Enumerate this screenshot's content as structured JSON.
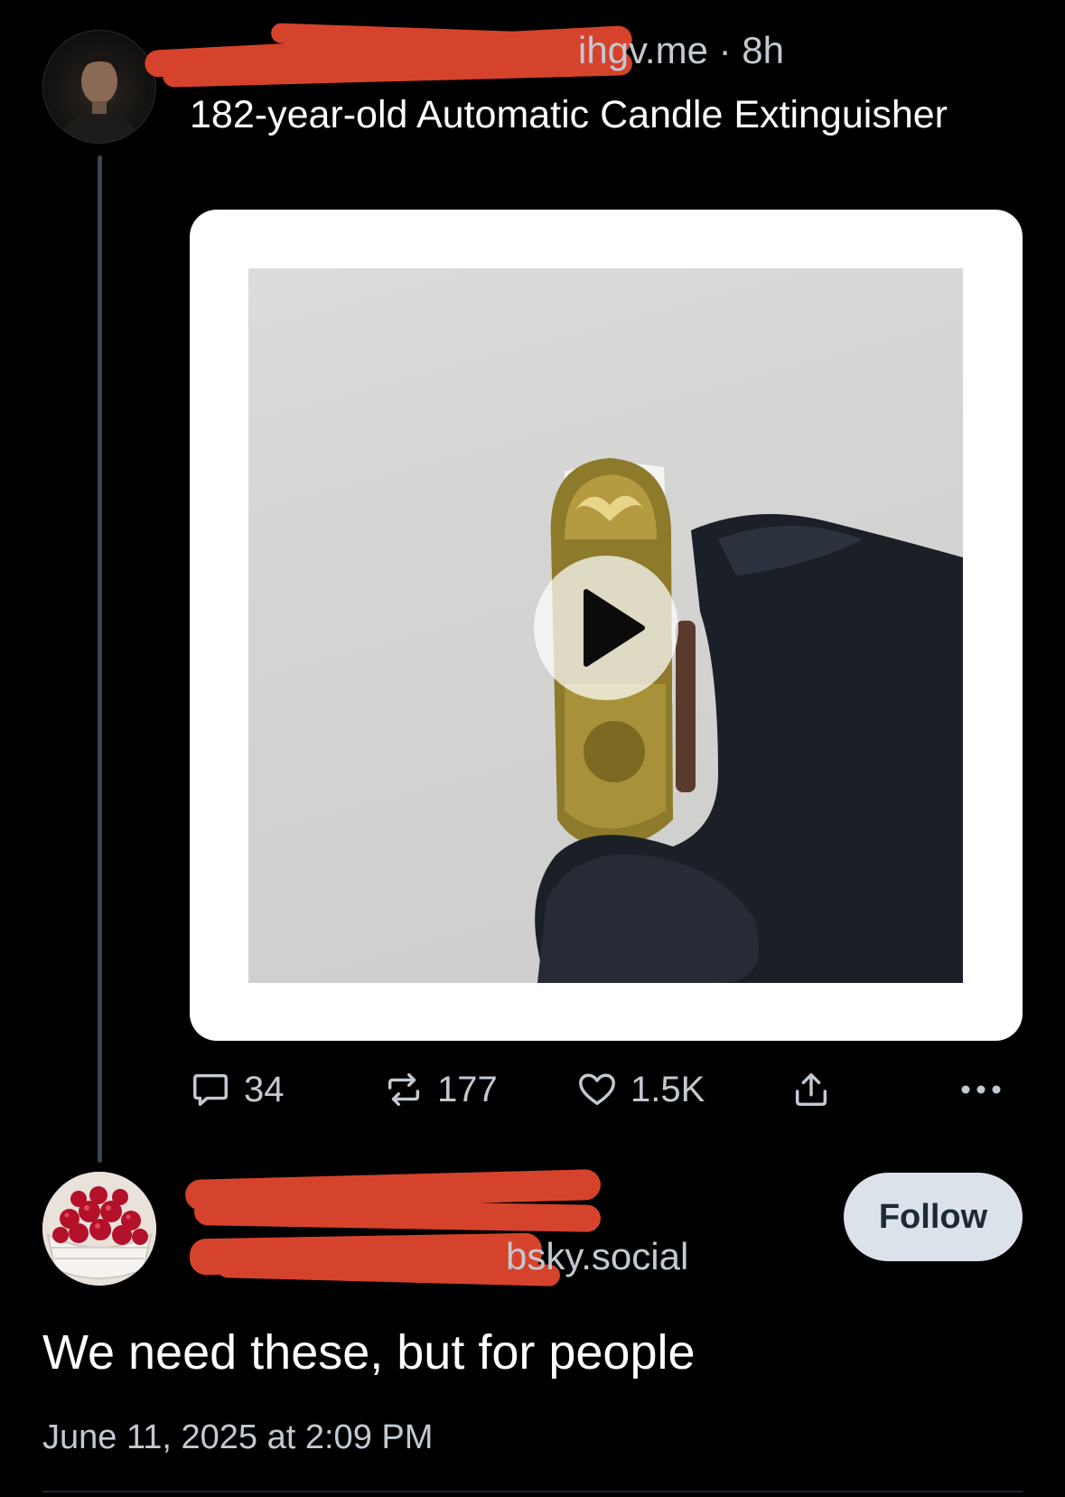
{
  "parent_post": {
    "author_handle_visible": "ihgv.me",
    "separator": "·",
    "time_ago": "8h",
    "text": "182-year-old Automatic Candle Extinguisher",
    "media": {
      "type": "video",
      "play_icon": "play-icon"
    },
    "actions": {
      "replies": "34",
      "reposts": "177",
      "likes": "1.5K",
      "reply_icon": "speech-bubble-icon",
      "repost_icon": "repost-arrows-icon",
      "like_icon": "heart-icon",
      "share_icon": "share-upload-icon",
      "more_icon": "more-dots-icon"
    }
  },
  "reply_post": {
    "handle_visible": "bsky.social",
    "follow_label": "Follow",
    "text": "We need these, but for people",
    "timestamp": "June 11, 2025 at 2:09 PM"
  },
  "colors": {
    "background": "#000000",
    "secondary_text": "#c2c9d1",
    "redaction": "#d6432c",
    "follow_button": "#dce2ea"
  }
}
